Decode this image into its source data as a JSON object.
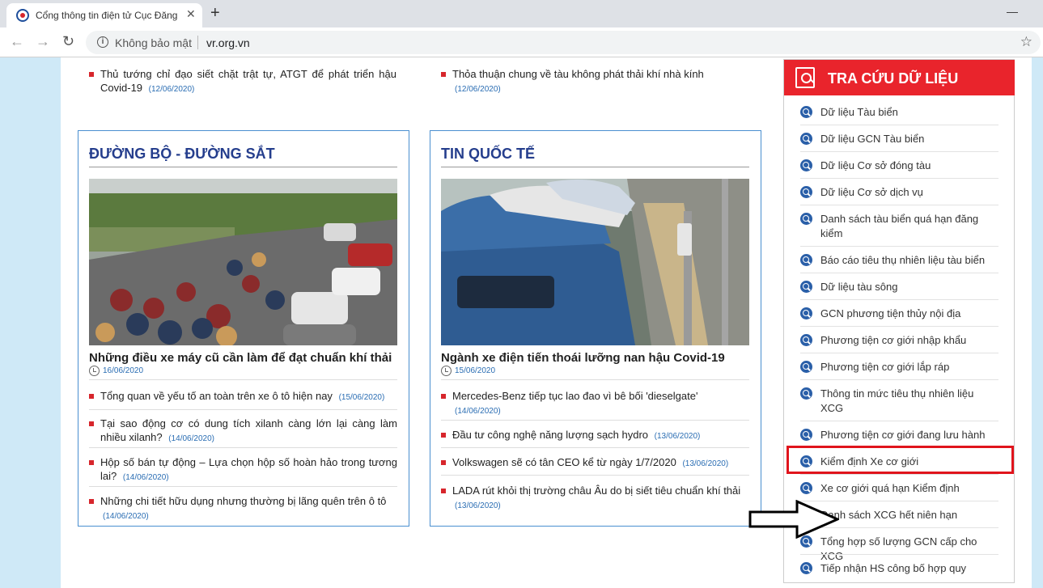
{
  "browser": {
    "tab_title": "Cổng thông tin điện tử Cục Đăng kiểm Việt Nam",
    "tab_close": "✕",
    "new_tab": "+",
    "minimize": "—",
    "maximize": "☐",
    "back": "←",
    "forward": "→",
    "reload": "↻",
    "security_label": "Không bảo mật",
    "url": "vr.org.vn",
    "star": "☆"
  },
  "top_news": {
    "left": {
      "title": "Thủ tướng chỉ đạo siết chặt trật tự, ATGT để phát triển hậu Covid-19",
      "date": "(12/06/2020)"
    },
    "right": {
      "title": "Thỏa thuận chung về tàu không phát thải khí nhà kính",
      "date": "(12/06/2020)"
    }
  },
  "road_box": {
    "title": "ĐƯỜNG BỘ - ĐƯỜNG SẮT",
    "feature_title": "Những điều xe máy cũ cần làm để đạt chuẩn khí thải",
    "feature_date": "16/06/2020",
    "items": [
      {
        "title": "Tổng quan về yếu tố an toàn trên xe ô tô hiện nay",
        "date": "(15/06/2020)"
      },
      {
        "title": "Tại sao động cơ có dung tích xilanh càng lớn lại càng làm nhiều xilanh?",
        "date": "(14/06/2020)"
      },
      {
        "title": "Hộp số bán tự động – Lựa chọn hộp số hoàn hảo trong tương lai?",
        "date": "(14/06/2020)"
      },
      {
        "title": "Những chi tiết hữu dụng nhưng thường bị lãng quên trên ô tô",
        "date": "(14/06/2020)"
      }
    ]
  },
  "intl_box": {
    "title": "TIN QUỐC TẾ",
    "feature_title": "Ngành xe điện tiến thoái lưỡng nan hậu Covid-19",
    "feature_date": "15/06/2020",
    "items": [
      {
        "title": "Mercedes-Benz tiếp tục lao đao vì bê bối 'dieselgate'",
        "date": "(14/06/2020)"
      },
      {
        "title": "Đầu tư công nghệ năng lượng sạch hydro",
        "date": "(13/06/2020)"
      },
      {
        "title": "Volkswagen sẽ có tân CEO kể từ ngày 1/7/2020",
        "date": "(13/06/2020)"
      },
      {
        "title": "LADA rút khỏi thị trường châu Âu do bị siết tiêu chuẩn khí thải",
        "date": "(13/06/2020)"
      }
    ]
  },
  "lookup_panel": {
    "title": "TRA CỨU DỮ LIỆU",
    "links": [
      "Dữ liệu Tàu biển",
      "Dữ liệu GCN Tàu biển",
      "Dữ liệu Cơ sở đóng tàu",
      "Dữ liệu Cơ sở dịch vụ",
      "Danh sách tàu biển quá hạn đăng kiểm",
      "Báo cáo tiêu thụ nhiên liệu tàu biển",
      "Dữ liệu tàu sông",
      "GCN phương tiện thủy nội địa",
      "Phương tiện cơ giới nhập khẩu",
      "Phương tiện cơ giới lắp ráp",
      "Thông tin mức tiêu thụ nhiên liệu XCG",
      "Phương tiện cơ giới đang lưu hành",
      "Kiểm định Xe cơ giới",
      "Xe cơ giới quá hạn Kiểm định",
      "Danh sách XCG hết niên hạn",
      "Tổng hợp số lượng GCN cấp cho XCG",
      "Tiếp nhận HS công bố hợp quy"
    ]
  },
  "colors": {
    "accent_red": "#e9242c",
    "title_blue": "#253e8d",
    "link_blue": "#2a6db3",
    "highlight": "#e0141c"
  }
}
